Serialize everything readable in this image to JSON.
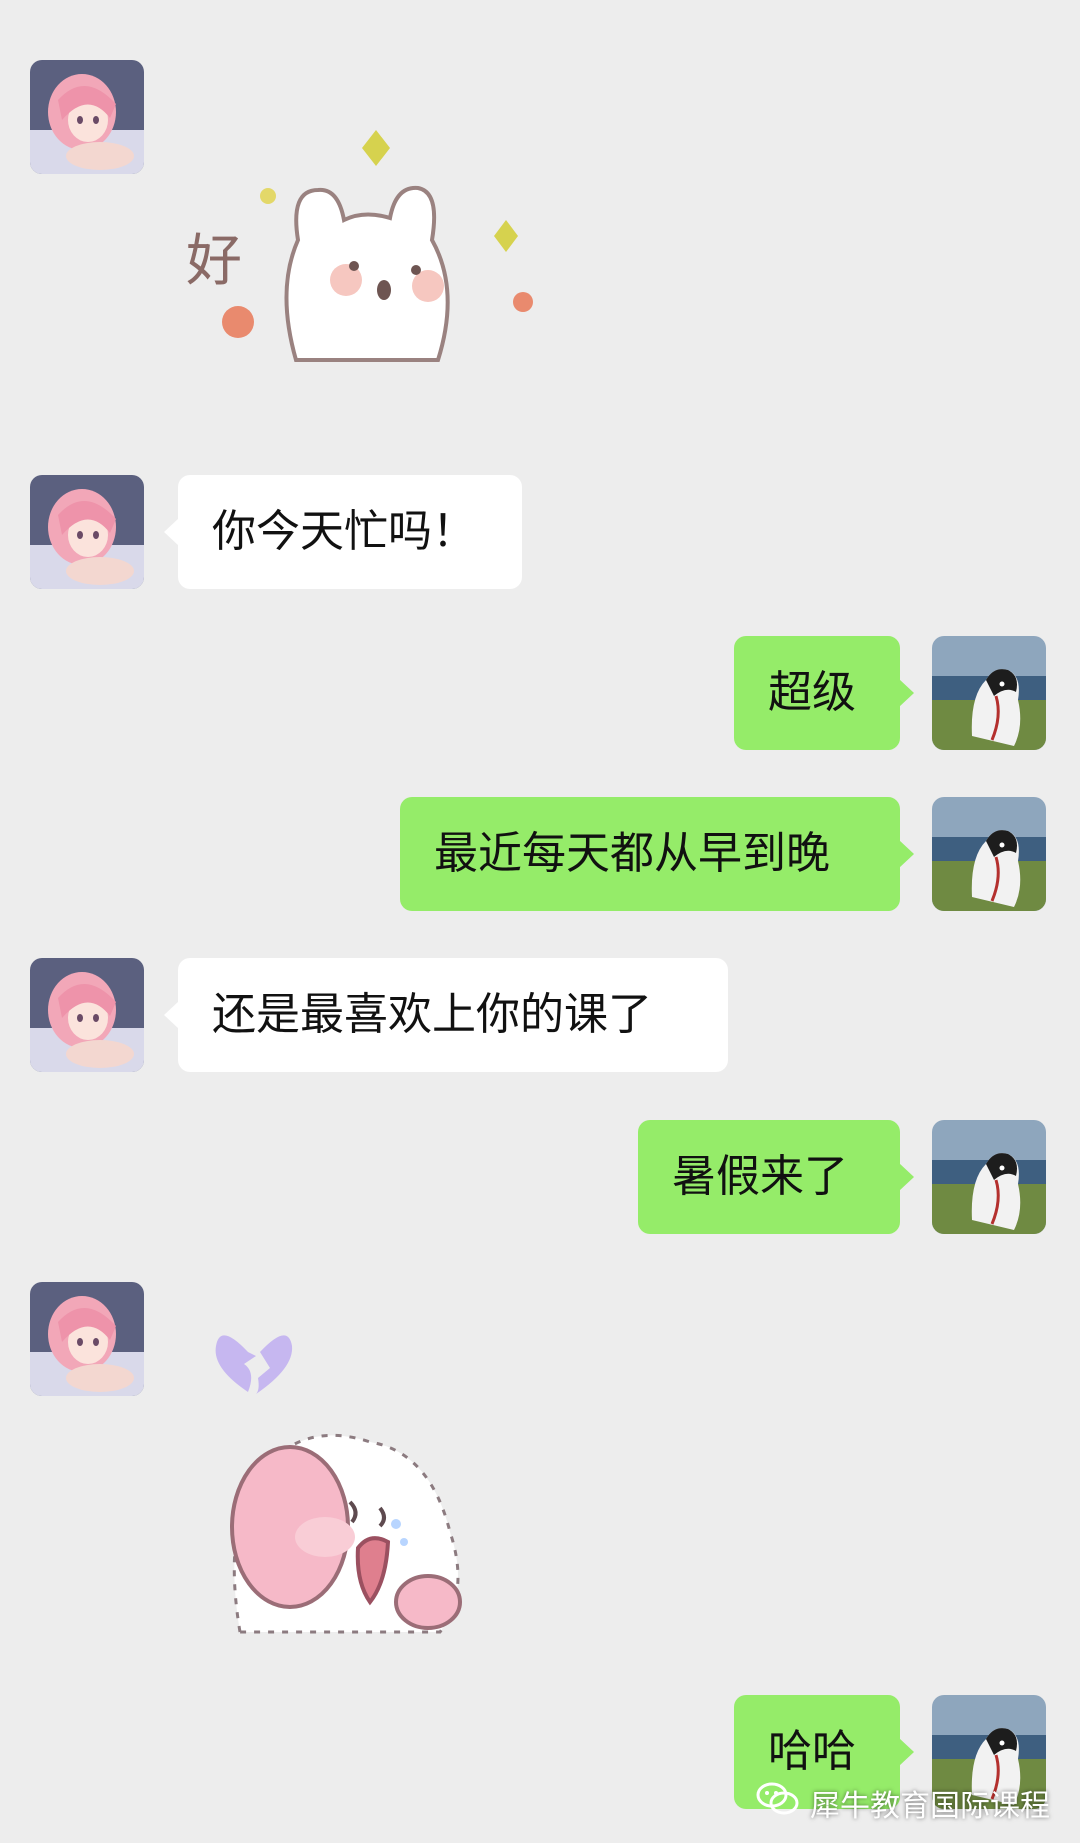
{
  "messages": [
    {
      "id": 1,
      "from": "other",
      "type": "sticker",
      "sticker": "bunny-good-sticker",
      "sticker_text": "好"
    },
    {
      "id": 2,
      "from": "other",
      "type": "text",
      "text": "你今天忙吗！"
    },
    {
      "id": 3,
      "from": "self",
      "type": "text",
      "text": "超级"
    },
    {
      "id": 4,
      "from": "self",
      "type": "text",
      "text": "最近每天都从早到晚"
    },
    {
      "id": 5,
      "from": "other",
      "type": "text",
      "text": "还是最喜欢上你的课了"
    },
    {
      "id": 6,
      "from": "self",
      "type": "text",
      "text": "暑假来了"
    },
    {
      "id": 7,
      "from": "other",
      "type": "sticker",
      "sticker": "bunny-crying-broken-heart-sticker"
    },
    {
      "id": 8,
      "from": "self",
      "type": "text",
      "text": "哈哈"
    }
  ],
  "avatars": {
    "other": {
      "name": "anime-girl-avatar",
      "hair_color": "#f2a7b8"
    },
    "self": {
      "name": "husky-dog-avatar"
    }
  },
  "colors": {
    "background": "#ededed",
    "incoming_bubble": "#ffffff",
    "outgoing_bubble": "#95ec69"
  },
  "watermark": {
    "icon": "wechat-icon",
    "text": "犀牛教育国际课程"
  }
}
